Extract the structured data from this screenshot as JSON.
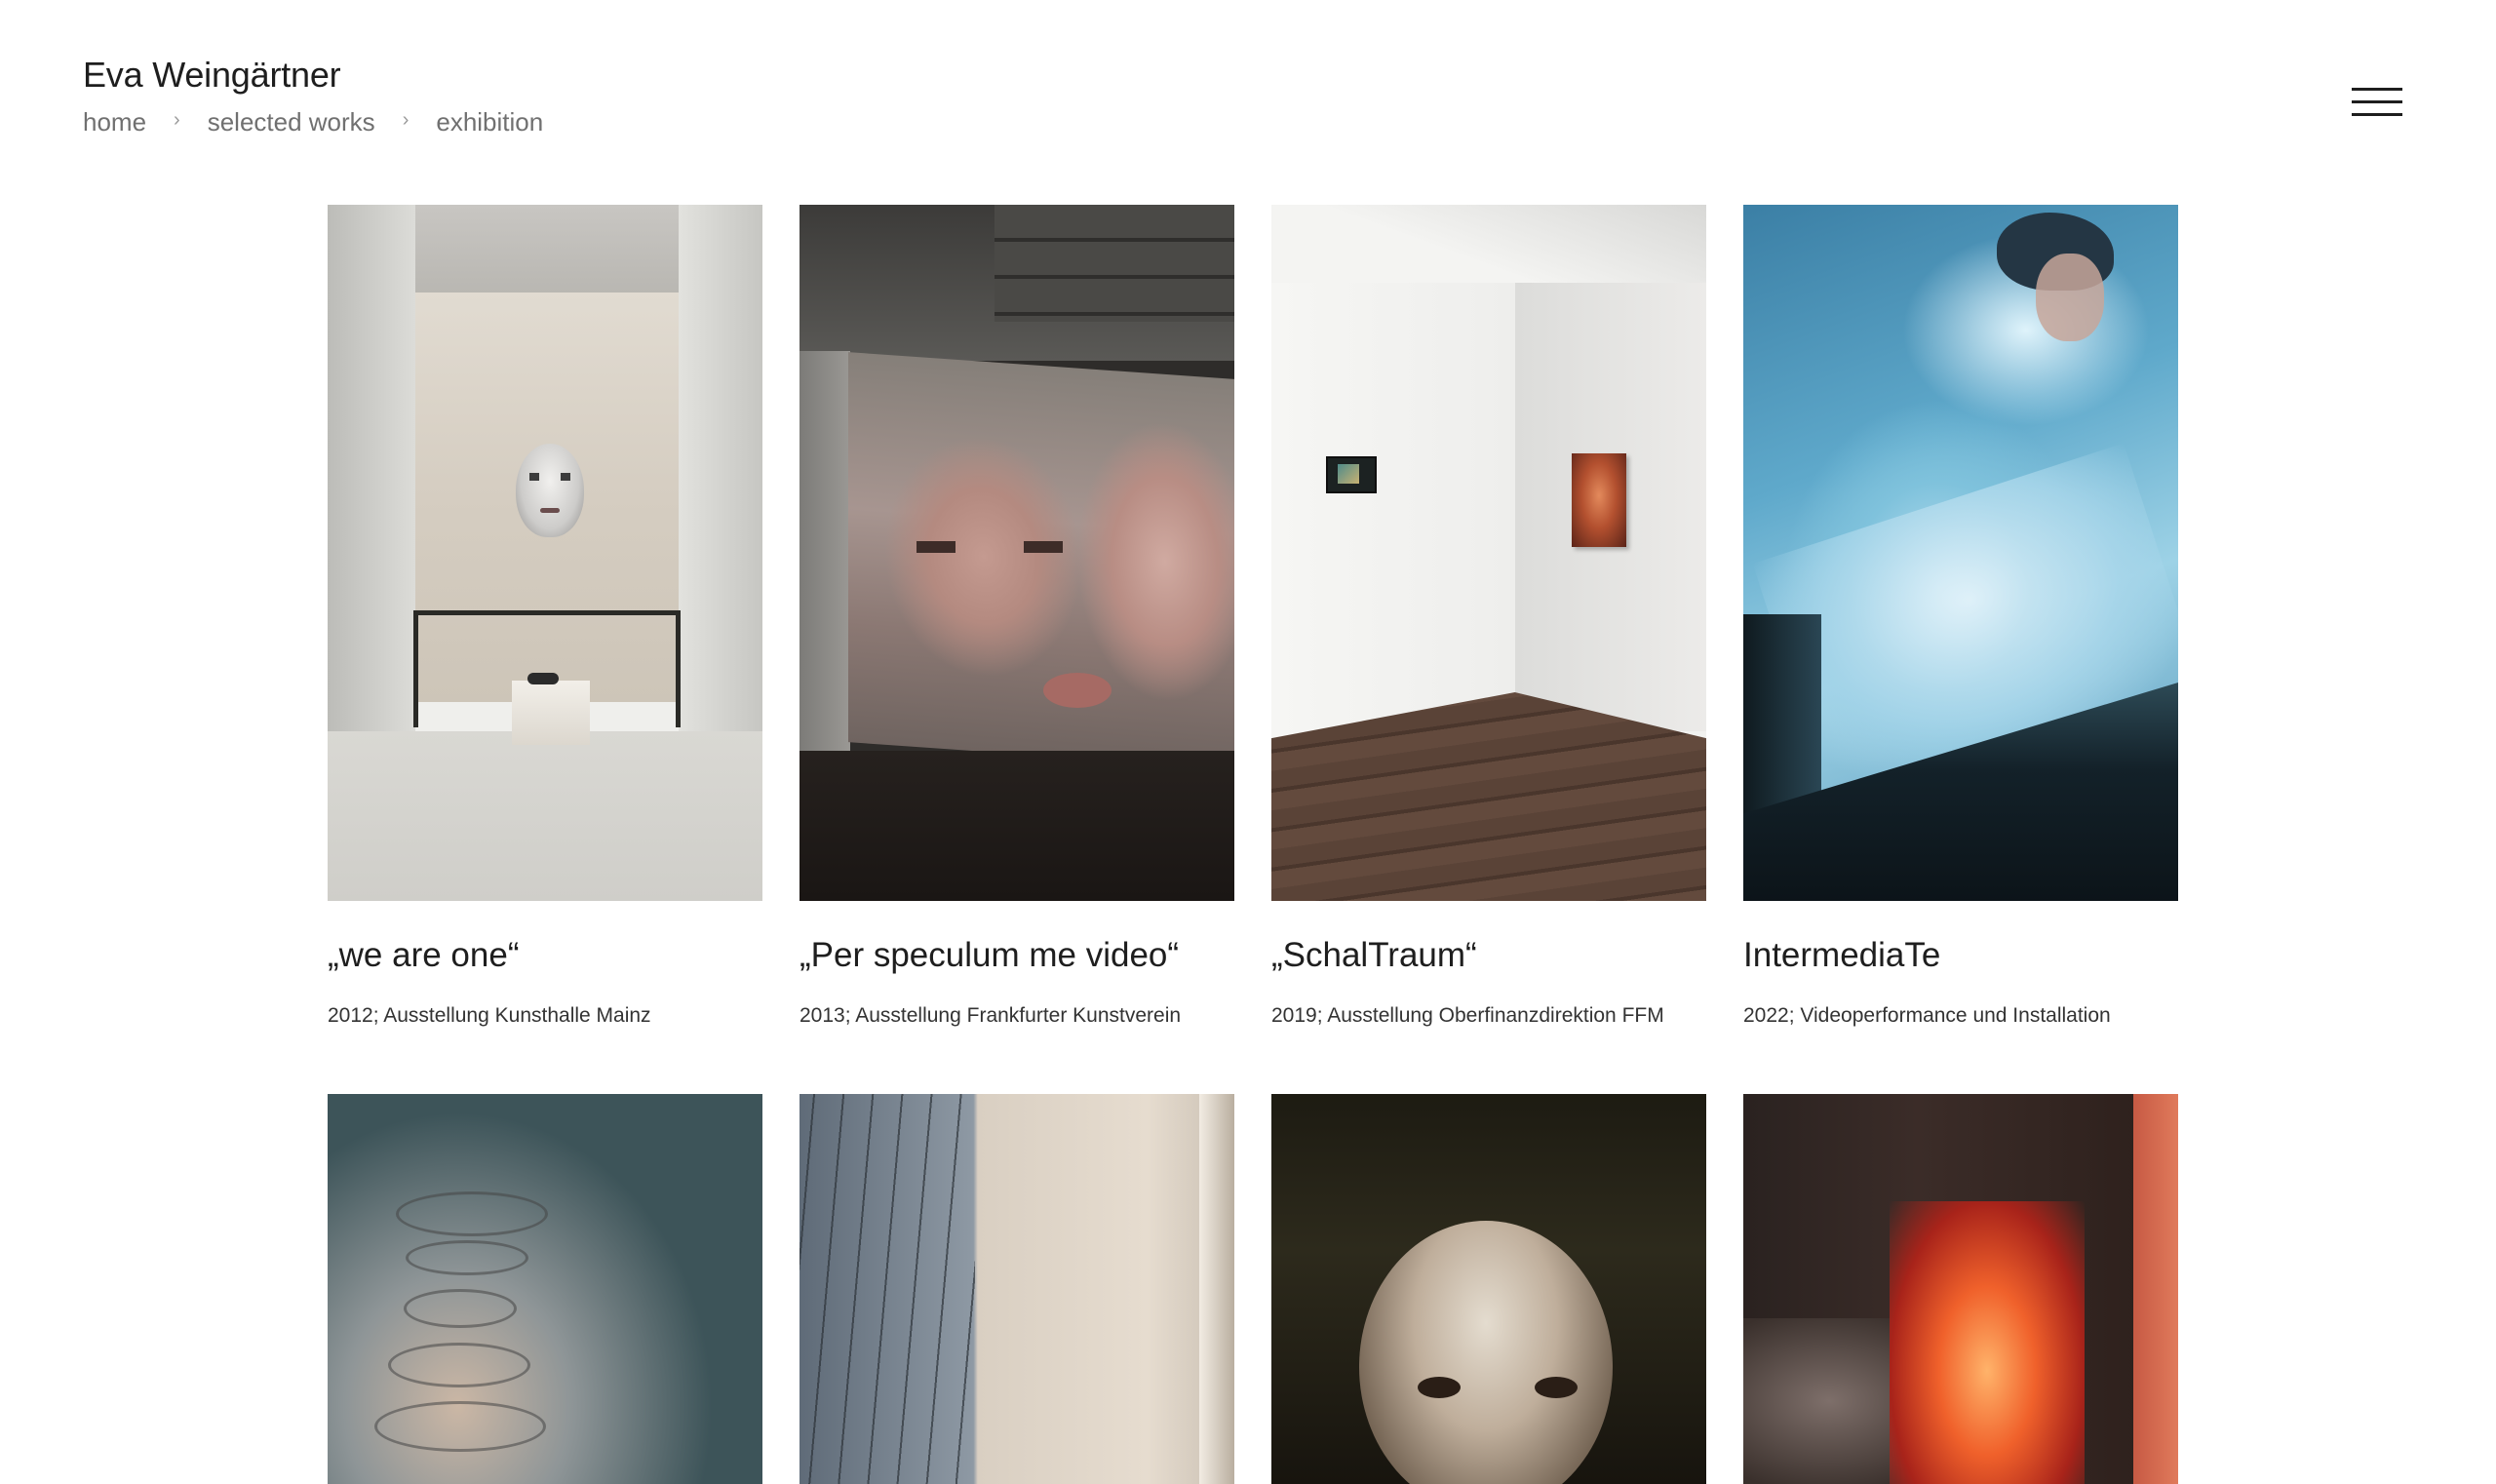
{
  "site": {
    "title": "Eva Weingärtner"
  },
  "breadcrumb": {
    "items": [
      "home",
      "selected works",
      "exhibition"
    ],
    "separator": "›"
  },
  "menu": {
    "icon": "hamburger-menu-icon"
  },
  "works": [
    {
      "title": "„we are one“",
      "meta": "2012; Ausstellung Kunsthalle Mainz",
      "image": "gallery-corridor-projected-face"
    },
    {
      "title": "„Per speculum me video“",
      "meta": "2013; Ausstellung Frankfurter Kunstverein",
      "image": "video-projection-kiss"
    },
    {
      "title": "„SchalTraum“",
      "meta": "2019; Ausstellung Oberfinanzdirektion FFM",
      "image": "white-room-corner-installation"
    },
    {
      "title": "IntermediaTe",
      "meta": "2022; Videoperformance und Installation",
      "image": "blue-lit-performance"
    }
  ],
  "works_row2": [
    {
      "image": "hanging-wire-sculpture"
    },
    {
      "image": "projection-with-trees"
    },
    {
      "image": "face-closeup-dark"
    },
    {
      "image": "fire-projection"
    }
  ]
}
